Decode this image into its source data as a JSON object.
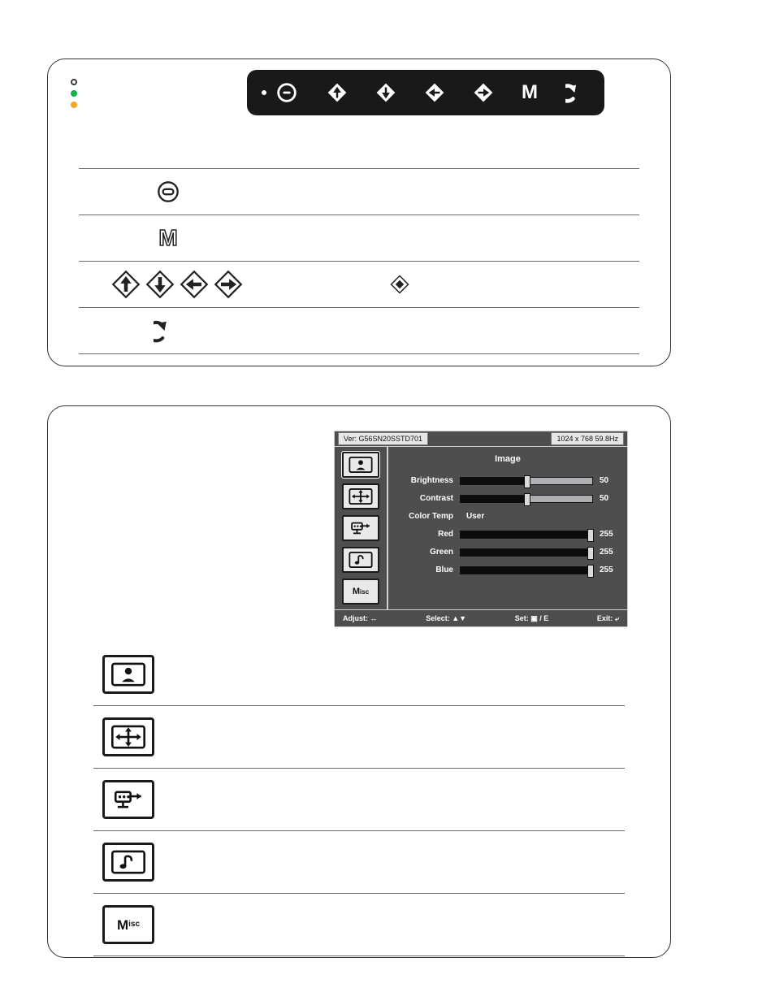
{
  "panel1": {
    "buttons_bar": [
      "power",
      "up",
      "down",
      "left",
      "right",
      "menu",
      "return"
    ],
    "rows": [
      "power",
      "menu",
      "nav",
      "return"
    ]
  },
  "panel2": {
    "osd": {
      "version_label": "Ver: G56SN20SSTD701",
      "mode_label": "1024 x 768  59.8Hz",
      "title": "Image",
      "sliders": [
        {
          "label": "Brightness",
          "value": 50,
          "max": 100
        },
        {
          "label": "Contrast",
          "value": 50,
          "max": 100
        }
      ],
      "color_temp_label": "Color Temp",
      "color_temp_value": "User",
      "rgb": [
        {
          "label": "Red",
          "value": 255,
          "max": 255
        },
        {
          "label": "Green",
          "value": 255,
          "max": 255
        },
        {
          "label": "Blue",
          "value": 255,
          "max": 255
        }
      ],
      "foot_adjust": "Adjust: ↔",
      "foot_select": "Select: ▲▼",
      "foot_set": "Set: ▣ / E",
      "foot_exit": "Exit: ⤶"
    },
    "tabs": [
      "image",
      "geometry",
      "input",
      "audio",
      "misc"
    ],
    "misc_label": "Misc"
  }
}
